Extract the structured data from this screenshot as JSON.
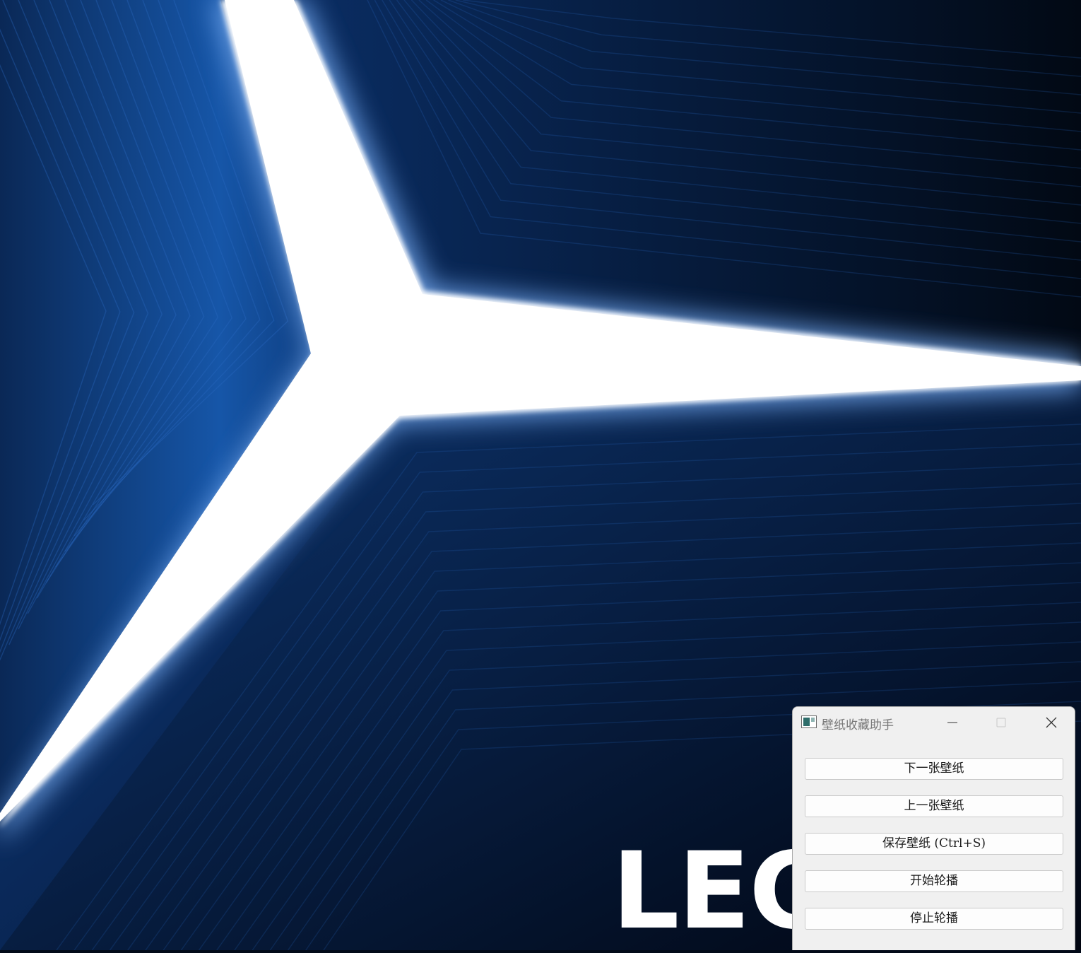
{
  "desktop": {
    "brand_text": "LEG",
    "colors": {
      "deep_navy": "#020a18",
      "mid_blue": "#0c3a78",
      "bright_blue": "#1a5fb4",
      "glow": "#ffffff"
    }
  },
  "window": {
    "title": "壁纸收藏助手",
    "app_icon": "image-icon",
    "controls": {
      "minimize": "minimize-icon",
      "maximize": "maximize-icon",
      "close": "close-icon"
    },
    "buttons": [
      {
        "label": "下一张壁纸"
      },
      {
        "label": "上一张壁纸"
      },
      {
        "label": "保存壁纸 (Ctrl+S)"
      },
      {
        "label": "开始轮播"
      },
      {
        "label": "停止轮播"
      }
    ]
  }
}
